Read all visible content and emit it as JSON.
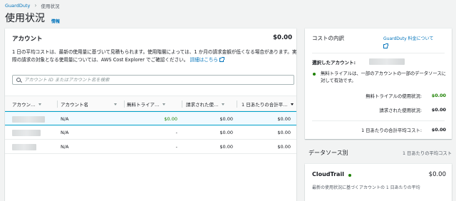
{
  "breadcrumb": {
    "root": "GuardDuty",
    "current": "使用状況"
  },
  "page": {
    "title": "使用状況",
    "info": "情報"
  },
  "accounts": {
    "title": "アカウント",
    "total": "$0.00",
    "description_1": "1 日の平均コストは、最新の使用量に基づいて見積もられます。使用階層によっては、1 か月の請求金額が低くなる場合があります。実際の請求の対象となる使用量については、AWS Cost Explorer でご確認ください。",
    "details_link": "詳細はこちら",
    "search_placeholder": "アカウント ID またはアカウント名を検索",
    "columns": [
      "アカウン…",
      "アカウント名",
      "無料トライア…",
      "請求された使…",
      "1 日あたりの合計平…"
    ],
    "rows": [
      {
        "name": "N/A",
        "trial": "$0.00",
        "billed": "$0.00",
        "daily": "$0.00",
        "selected": true
      },
      {
        "name": "N/A",
        "trial": "-",
        "billed": "$0.00",
        "daily": "$0.00",
        "selected": false
      },
      {
        "name": "N/A",
        "trial": "-",
        "billed": "$0.00",
        "daily": "$0.00",
        "selected": false
      }
    ]
  },
  "cost_breakdown": {
    "title": "コストの内訳",
    "pricing_link": "GuardDuty 料金について",
    "selected_account_label": "選択したアカウント:",
    "trial_note": "無料トライアルは、一部のアカウントの一部のデータソースに対して有効です。",
    "trial_usage_label": "無料トライアルの使用状況:",
    "trial_usage_value": "$0.00",
    "billed_usage_label": "請求された使用状況:",
    "billed_usage_value": "$0.00",
    "daily_avg_label": "1 日あたりの合計平均コスト:",
    "daily_avg_value": "$0.00"
  },
  "by_data_source": {
    "title": "データソース別",
    "subtitle": "1 日あたりの平均コスト",
    "item_name": "CloudTrail",
    "item_value": "$0.00",
    "item_desc": "最新の使用状況に基づくアカウントの 1 日あたりの平均"
  },
  "colors": {
    "link": "#0073bb",
    "green": "#1d8102",
    "selected_row": "#f1faff"
  }
}
